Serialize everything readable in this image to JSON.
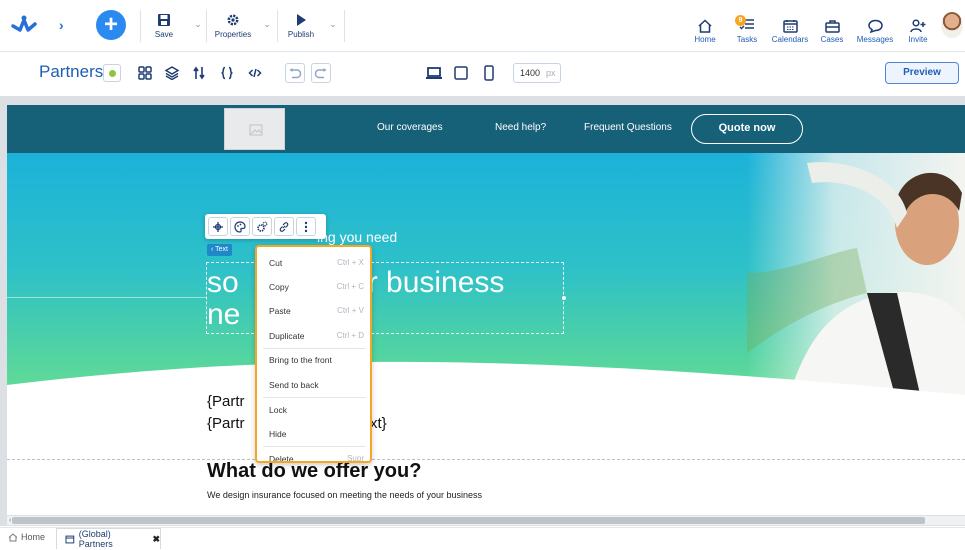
{
  "toolbar": {
    "save": "Save",
    "properties": "Properties",
    "publish": "Publish"
  },
  "right_nav": {
    "home": "Home",
    "tasks": "Tasks",
    "tasks_badge": "9",
    "calendars": "Calendars",
    "cases": "Cases",
    "messages": "Messages",
    "invite": "Invite"
  },
  "page": {
    "title": "Partners",
    "width_value": "1400",
    "width_unit": "px",
    "preview": "Preview"
  },
  "site": {
    "nav_links": [
      "Our coverages",
      "Need help?",
      "Frequent Questions"
    ],
    "quote_button": "Quote now",
    "hero_subtitle_visible": "ing you need",
    "hero_title_line1_a": "so",
    "hero_title_line1_b": "r business",
    "hero_title_line2": "ne",
    "text_tag": "‹ Text",
    "body_line1": "{Partr",
    "body_line2": "{Partr",
    "body_line2_end": "xt}",
    "offer_title": "What do we offer you?",
    "offer_subtitle": "We design insurance focused on meeting the needs of your business"
  },
  "context_menu": [
    {
      "label": "Cut",
      "shortcut": "Ctrl + X"
    },
    {
      "label": "Copy",
      "shortcut": "Ctrl + C"
    },
    {
      "label": "Paste",
      "shortcut": "Ctrl + V"
    },
    {
      "label": "Duplicate",
      "shortcut": "Ctrl + D"
    },
    {
      "label": "Bring to the front",
      "shortcut": ""
    },
    {
      "label": "Send to back",
      "shortcut": ""
    },
    {
      "label": "Lock",
      "shortcut": ""
    },
    {
      "label": "Hide",
      "shortcut": ""
    },
    {
      "label": "Delete",
      "shortcut": "Supr"
    }
  ],
  "bottom_tabs": {
    "home": "Home",
    "active": "(Global) Partners"
  },
  "colors": {
    "brand_blue": "#1e5eb5",
    "nav_teal": "#176178",
    "menu_border": "#f5a623"
  }
}
